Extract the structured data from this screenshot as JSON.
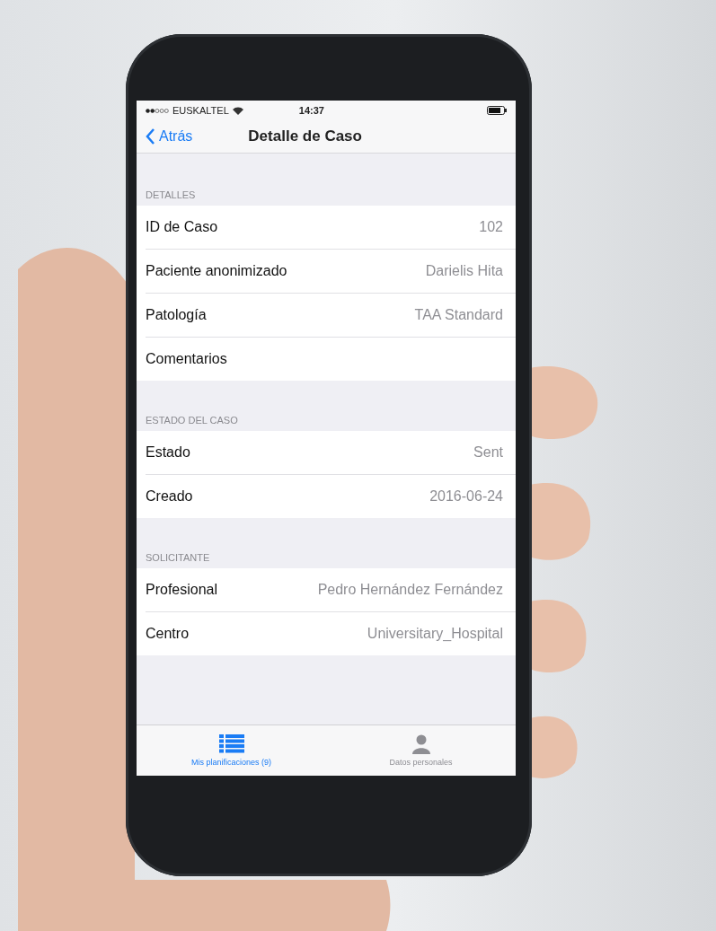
{
  "status_bar": {
    "carrier": "EUSKALTEL",
    "time": "14:37"
  },
  "nav_bar": {
    "back": "Atrás",
    "title": "Detalle de Caso"
  },
  "sections": [
    {
      "header": "DETALLES",
      "rows": [
        {
          "label": "ID de Caso",
          "value": "102"
        },
        {
          "label": "Paciente anonimizado",
          "value": "Darielis Hita"
        },
        {
          "label": "Patología",
          "value": "TAA Standard"
        },
        {
          "label": "Comentarios"
        }
      ]
    },
    {
      "header": "ESTADO DEL CASO",
      "rows": [
        {
          "label": "Estado",
          "value": "Sent"
        },
        {
          "label": "Creado",
          "value": "2016-06-24"
        }
      ]
    },
    {
      "header": "SOLICITANTE",
      "rows": [
        {
          "label": "Profesional",
          "value": "Pedro Hernández Fernández"
        },
        {
          "label": "Centro",
          "value": "Universitary_Hospital"
        }
      ]
    }
  ],
  "tab_bar": [
    {
      "kind": "list",
      "label": "Mis planificaciones (9)",
      "selected": true
    },
    {
      "kind": "person",
      "label": "Datos personales",
      "selected": false
    }
  ]
}
